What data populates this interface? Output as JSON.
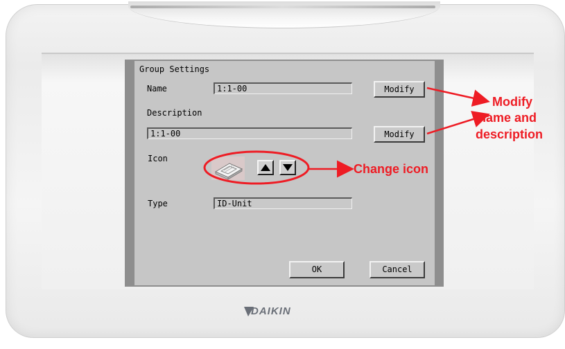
{
  "dialog": {
    "title": "Group Settings",
    "name_label": "Name",
    "name_value": "1:1-00",
    "name_modify_label": "Modify",
    "description_label": "Description",
    "description_value": "1:1-00",
    "description_modify_label": "Modify",
    "icon_label": "Icon",
    "type_label": "Type",
    "type_value": "ID-Unit",
    "ok_label": "OK",
    "cancel_label": "Cancel"
  },
  "annotations": {
    "modify_line1": "Modify",
    "modify_line2": "name and",
    "modify_line3": "description",
    "change_icon": "Change icon",
    "color": "#ee1c24"
  },
  "device": {
    "brand": "DAIKIN"
  },
  "icons": [
    "cassette-unit-icon",
    "arrow-up-icon",
    "arrow-down-icon",
    "daikin-logo-icon"
  ]
}
